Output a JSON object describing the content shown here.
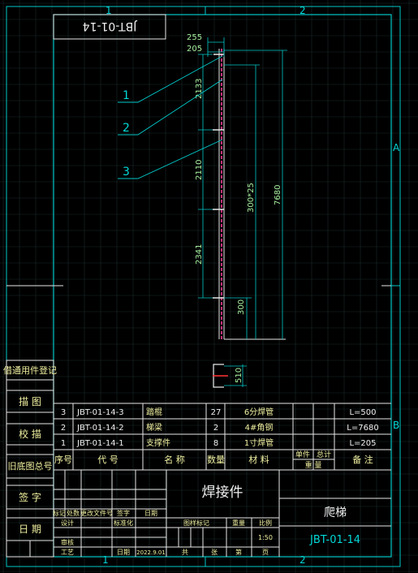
{
  "zone_labels": {
    "top_1": "1",
    "top_2": "2",
    "right_a": "A",
    "right_b": "B",
    "bottom_1": "1",
    "bottom_2": "2"
  },
  "drawing_number_upside": "JBT-01-14",
  "dimensions": {
    "d255": "255",
    "d205": "205",
    "d2133": "2133",
    "d2110": "2110",
    "d2341": "2341",
    "d300": "300",
    "d300x25": "300*25",
    "d7680": "7680",
    "d510": "510"
  },
  "callouts": [
    "1",
    "2",
    "3"
  ],
  "left_strip": [
    "借通用件登记",
    "描 图",
    "校 描",
    "旧底图总号",
    "签 字",
    "日 期"
  ],
  "bom": {
    "rows": [
      {
        "no": "3",
        "code": "JBT-01-14-3",
        "name": "踏棍",
        "qty": "27",
        "material": "6分焊管",
        "note": "L=500"
      },
      {
        "no": "2",
        "code": "JBT-01-14-2",
        "name": "梯梁",
        "qty": "2",
        "material": "4#角钢",
        "note": "L=7680"
      },
      {
        "no": "1",
        "code": "JBT-01-14-1",
        "name": "支撑件",
        "qty": "8",
        "material": "1寸焊管",
        "note": "L=205"
      }
    ],
    "header": {
      "no": "序号",
      "code": "代 号",
      "name": "名 称",
      "qty": "数量",
      "material": "材 料",
      "unit_w": "单件",
      "total_w": "总计",
      "weight": "重 量",
      "note": "备 注"
    }
  },
  "title_block": {
    "part_name": "焊接件",
    "assembly_name": "爬梯",
    "drawing_no": "JBT-01-14",
    "scale": "1:50",
    "labels": {
      "mark": "标记",
      "count": "处数",
      "change_doc": "更改文件号",
      "sign": "签字",
      "date": "日期",
      "design": "设计",
      "standardize": "标准化",
      "review": "审核",
      "process": "工艺",
      "stage_mark": "图样标记",
      "weight": "重量",
      "ratio": "比例",
      "total": "共",
      "sheet": "张",
      "page": "第",
      "page2": "页",
      "date2": "日期",
      "date_value": "2022.9.01"
    }
  }
}
